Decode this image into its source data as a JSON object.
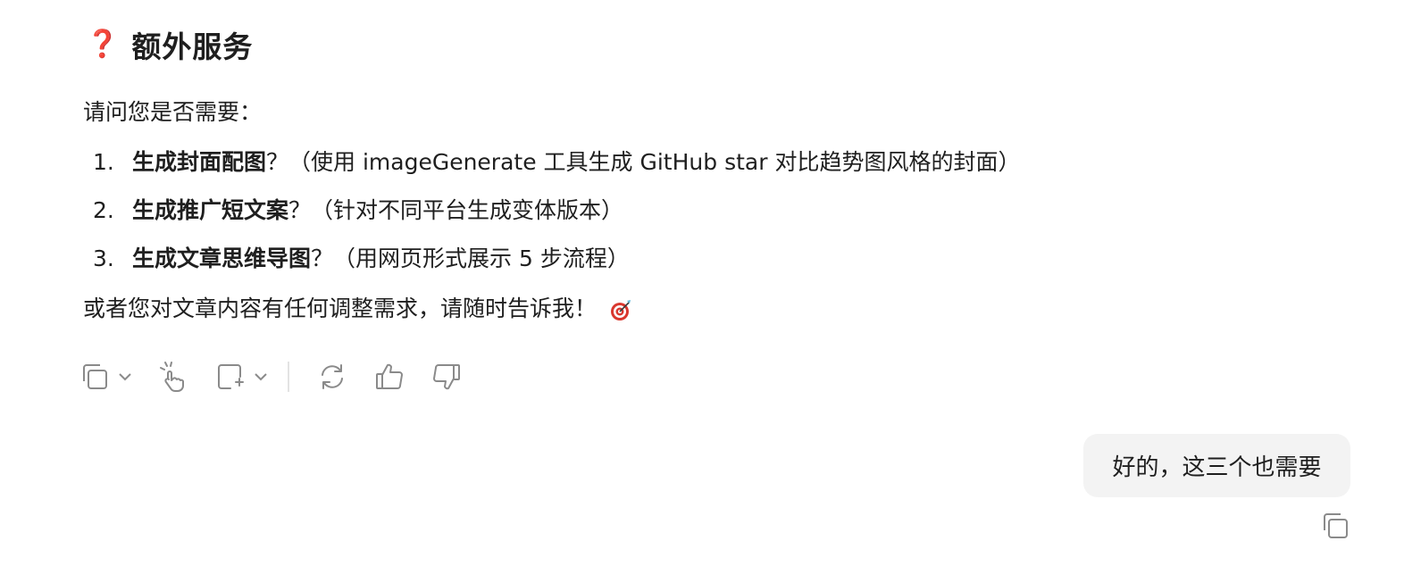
{
  "section": {
    "icon": "question-mark-icon",
    "icon_glyph": "❓",
    "title": "额外服务"
  },
  "intro": "请问您是否需要：",
  "items": [
    {
      "num": "1.",
      "bold": "生成封面配图",
      "rest": "？（使用 imageGenerate 工具生成 GitHub star 对比趋势图风格的封面）"
    },
    {
      "num": "2.",
      "bold": "生成推广短文案",
      "rest": "？（针对不同平台生成变体版本）"
    },
    {
      "num": "3.",
      "bold": "生成文章思维导图",
      "rest": "？（用网页形式展示 5 步流程）"
    }
  ],
  "outro": "或者您对文章内容有任何调整需求，请随时告诉我！",
  "outro_icon": "target-dart-icon",
  "toolbar": {
    "icons": [
      "copy-icon",
      "chevron-down-icon",
      "hand-pointer-icon",
      "add-note-icon",
      "chevron-down-icon",
      "refresh-icon",
      "thumbs-up-icon",
      "thumbs-down-icon"
    ]
  },
  "user_message": "好的，这三个也需要",
  "user_copy_icon": "copy-icon",
  "colors": {
    "accent_red": "#d9372e",
    "bubble_bg": "#f3f3f3",
    "icon_gray": "#8a8a8a"
  }
}
